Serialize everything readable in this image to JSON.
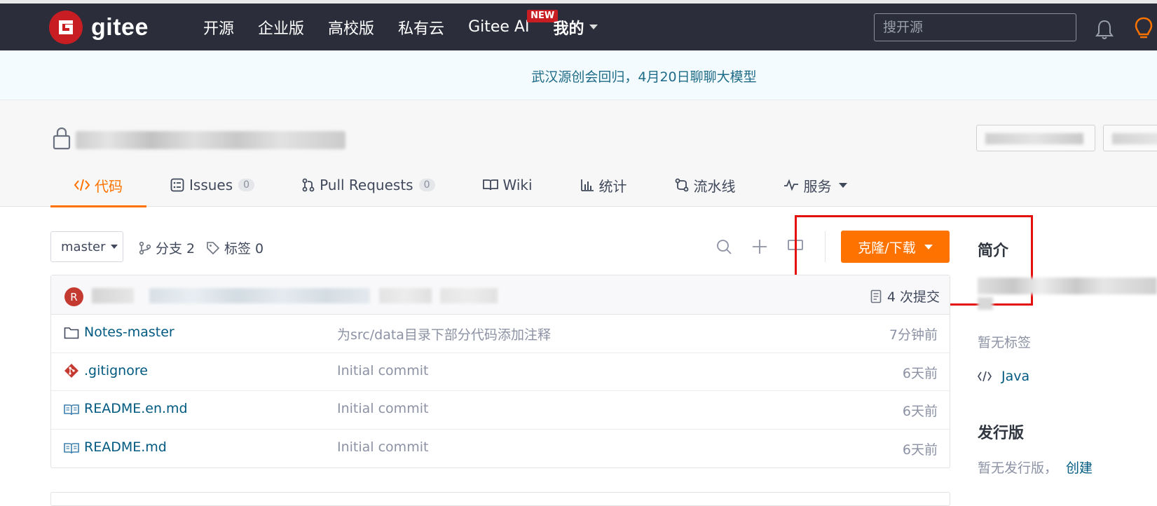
{
  "header": {
    "logo_text": "gitee",
    "nav": [
      "开源",
      "企业版",
      "高校版",
      "私有云"
    ],
    "nav_ai": "Gitee AI",
    "new_badge": "NEW",
    "nav_mine": "我的",
    "search_placeholder": "搜开源"
  },
  "banner": {
    "text": "武汉源创会回归，4月20日聊聊大模型"
  },
  "tabs": {
    "code": "代码",
    "issues": "Issues",
    "issues_count": "0",
    "pull_requests": "Pull Requests",
    "pr_count": "0",
    "wiki": "Wiki",
    "stats": "统计",
    "pipeline": "流水线",
    "services": "服务"
  },
  "toolbar": {
    "branch": "master",
    "branches": "分支 2",
    "tags": "标签 0",
    "clone_label": "克隆/下载"
  },
  "commit_bar": {
    "avatar_letter": "R",
    "commits": "4 次提交"
  },
  "files": [
    {
      "icon": "folder-icon",
      "name": "Notes-master",
      "message": "为src/data目录下部分代码添加注释",
      "time": "7分钟前"
    },
    {
      "icon": "git-icon",
      "name": ".gitignore",
      "message": "Initial commit",
      "time": "6天前"
    },
    {
      "icon": "book-icon",
      "name": "README.en.md",
      "message": "Initial commit",
      "time": "6天前"
    },
    {
      "icon": "book-icon",
      "name": "README.md",
      "message": "Initial commit",
      "time": "6天前"
    }
  ],
  "sidebar": {
    "intro_heading": "简介",
    "no_tags": "暂无标签",
    "language": "Java",
    "release_heading": "发行版",
    "no_release": "暂无发行版，",
    "create_link": "创建"
  },
  "colors": {
    "header_bg": "#2b2e3a",
    "accent": "#fe7300",
    "brand_red": "#c71d23",
    "link": "#005980",
    "highlight": "#e4100e"
  }
}
